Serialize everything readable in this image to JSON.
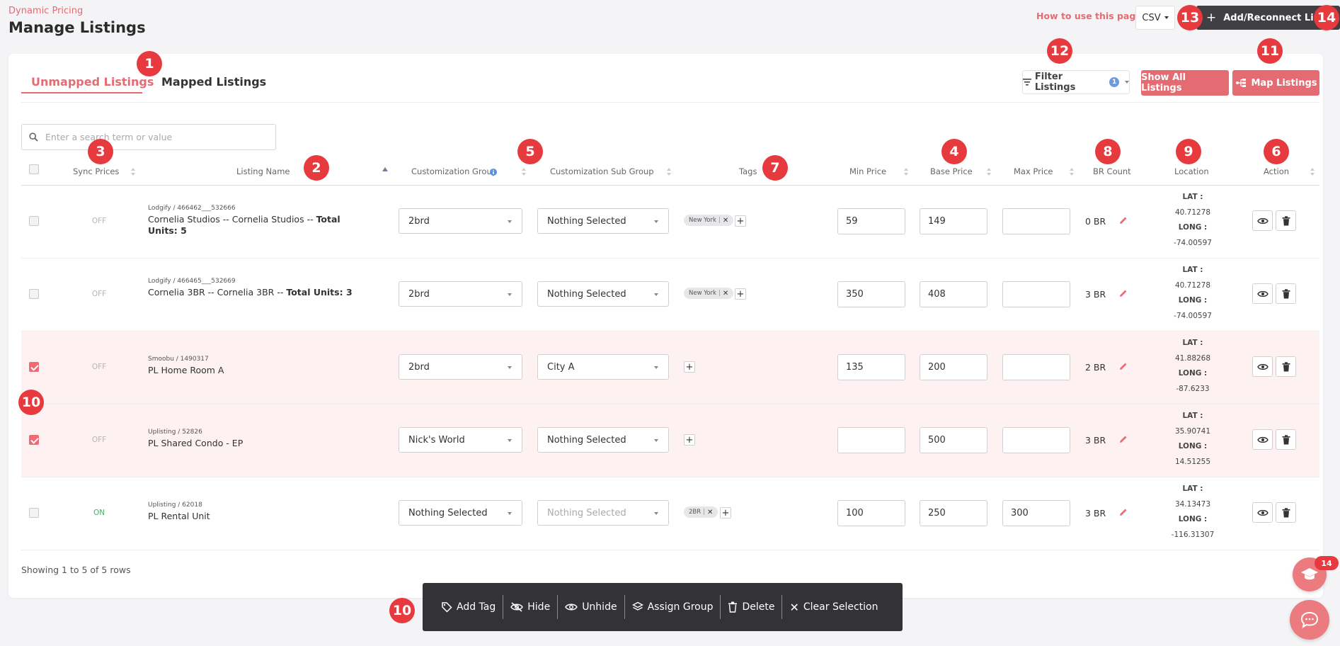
{
  "header": {
    "subtitle": "Dynamic Pricing",
    "title": "Manage Listings",
    "help_link": "How to use this page?",
    "export_format": "CSV",
    "add_button": "Add/Reconnect Listings"
  },
  "tabs": [
    {
      "label": "Unmapped Listings",
      "active": true
    },
    {
      "label": "Mapped Listings",
      "active": false
    }
  ],
  "toolbar": {
    "filter_label": "Filter Listings",
    "filter_count": "1",
    "show_all_label": "Show All Listings",
    "map_label": "Map Listings"
  },
  "search": {
    "placeholder": "Enter a search term or value",
    "value": ""
  },
  "columns": [
    "Sync Prices",
    "Listing Name",
    "Customization Group",
    "Customization Sub Group",
    "Tags",
    "Min Price",
    "Base Price",
    "Max Price",
    "BR Count",
    "Location",
    "Action"
  ],
  "location_labels": {
    "lat": "LAT :",
    "long": "LONG :"
  },
  "rows": [
    {
      "selected": false,
      "sync": "OFF",
      "sync_on": false,
      "source": "Lodgify / 466462___532666",
      "name": "Cornelia Studios -- Cornelia Studios -- ",
      "name_bold": "Total Units: 5",
      "group": "2brd",
      "sub_group": "Nothing Selected",
      "sub_group_disabled": false,
      "tags": [
        "New York"
      ],
      "min_price": "59",
      "base_price": "149",
      "max_price": "",
      "br_count": "0 BR",
      "lat": "40.71278",
      "long": "-74.00597"
    },
    {
      "selected": false,
      "sync": "OFF",
      "sync_on": false,
      "source": "Lodgify / 466465___532669",
      "name": "Cornelia 3BR -- Cornelia 3BR -- ",
      "name_bold": "Total Units: 3",
      "group": "2brd",
      "sub_group": "Nothing Selected",
      "sub_group_disabled": false,
      "tags": [
        "New York"
      ],
      "min_price": "350",
      "base_price": "408",
      "max_price": "",
      "br_count": "3 BR",
      "lat": "40.71278",
      "long": "-74.00597"
    },
    {
      "selected": true,
      "sync": "OFF",
      "sync_on": false,
      "source": "Smoobu / 1490317",
      "name": "PL Home Room A",
      "name_bold": "",
      "group": "2brd",
      "sub_group": "City A",
      "sub_group_disabled": false,
      "tags": [],
      "min_price": "135",
      "base_price": "200",
      "max_price": "",
      "br_count": "2 BR",
      "lat": "41.88268",
      "long": "-87.6233"
    },
    {
      "selected": true,
      "sync": "OFF",
      "sync_on": false,
      "source": "Uplisting / 52826",
      "name": "PL Shared Condo - EP",
      "name_bold": "",
      "group": "Nick's World",
      "sub_group": "Nothing Selected",
      "sub_group_disabled": false,
      "tags": [],
      "min_price": "",
      "base_price": "500",
      "max_price": "",
      "br_count": "3 BR",
      "lat": "35.90741",
      "long": "14.51255"
    },
    {
      "selected": false,
      "sync": "ON",
      "sync_on": true,
      "source": "Uplisting / 62018",
      "name": "PL Rental Unit",
      "name_bold": "",
      "group": "Nothing Selected",
      "sub_group": "Nothing Selected",
      "sub_group_disabled": true,
      "tags": [
        "2BR"
      ],
      "min_price": "100",
      "base_price": "250",
      "max_price": "300",
      "br_count": "3 BR",
      "lat": "34.13473",
      "long": "-116.31307"
    }
  ],
  "footer": {
    "showing": "Showing 1 to 5 of 5 rows"
  },
  "bulk_actions": [
    "Add Tag",
    "Hide",
    "Unhide",
    "Assign Group",
    "Delete",
    "Clear Selection"
  ],
  "markers": [
    "1",
    "2",
    "3",
    "4",
    "5",
    "6",
    "7",
    "8",
    "9",
    "10",
    "10",
    "11",
    "12",
    "13",
    "14"
  ],
  "notifications": {
    "count": "14"
  },
  "colors": {
    "accent": "#e56b73",
    "marker": "#e73a3f",
    "sync_on": "#3fb56a",
    "bulk_bar": "#333337"
  }
}
